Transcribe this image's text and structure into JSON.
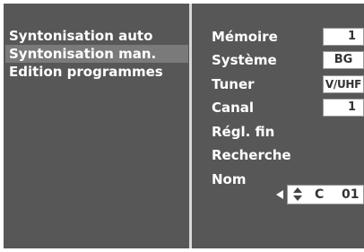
{
  "menu": {
    "items": [
      {
        "label": "Syntonisation auto",
        "selected": false
      },
      {
        "label": "Syntonisation man.",
        "selected": true
      },
      {
        "label": "Edition programmes",
        "selected": false
      }
    ]
  },
  "settings": {
    "memoire": {
      "label": "Mémoire",
      "value": "1"
    },
    "systeme": {
      "label": "Système",
      "value": "BG"
    },
    "tuner": {
      "label": "Tuner",
      "value": "V/UHF"
    },
    "canal": {
      "label": "Canal",
      "value": "1"
    },
    "regl_fin": {
      "label": "Régl. fin"
    },
    "recherche": {
      "label": "Recherche"
    },
    "nom": {
      "label": "Nom",
      "letter": "C",
      "number": "01"
    }
  },
  "icons": {
    "cursor": "left-arrow-icon",
    "updown": "up-down-arrows-icon"
  },
  "colors": {
    "background": "#575757",
    "selected_row": "#7a7a7a",
    "divider": "#d9d9d9",
    "value_box": "#ffffff"
  }
}
